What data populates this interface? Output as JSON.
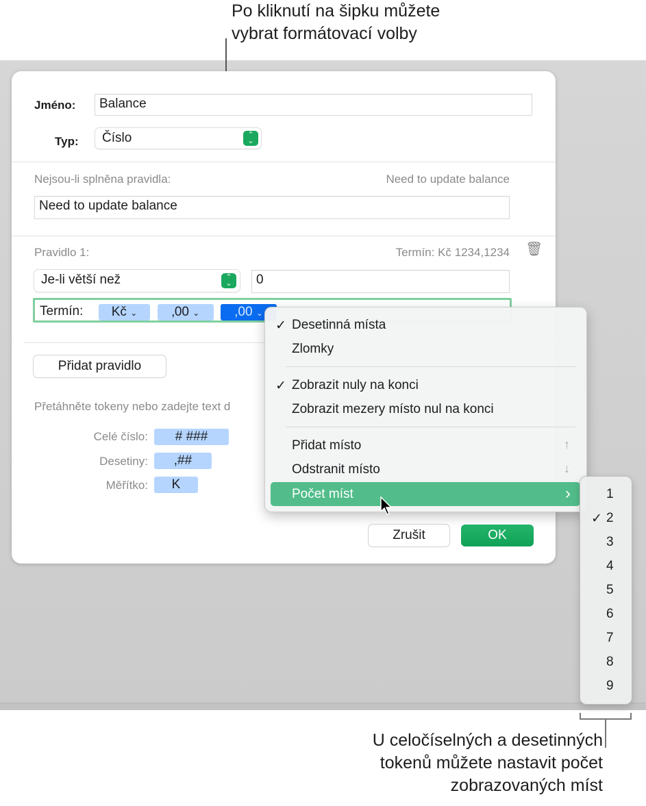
{
  "callouts": {
    "top": [
      "Po kliknutí na šipku můžete",
      "vybrat formátovací volby"
    ],
    "bottom": [
      "U celočíselných a desetinných",
      "tokenů můžete nastavit počet",
      "zobrazovaných míst"
    ]
  },
  "dialog": {
    "name_label": "Jméno:",
    "name_value": "Balance",
    "type_label": "Typ:",
    "type_value": "Číslo",
    "unmet_label": "Nejsou-li splněna pravidla:",
    "unmet_preview": "Need to update balance",
    "unmet_value": "Need to update balance",
    "rule_label": "Pravidlo 1:",
    "rule_preview": "Termín: Kč 1234,1234",
    "condition": "Je-li větší než",
    "condition_value": "0",
    "term_label": "Termín:",
    "tokens": [
      "Kč",
      "‚00",
      ",00"
    ],
    "add_rule": "Přidat pravidlo",
    "hint": "Přetáhněte tokeny nebo zadejte text d",
    "token_rows": [
      {
        "label": "Celé číslo:",
        "token": "# ###"
      },
      {
        "label": "Desetiny:",
        "token": ",##"
      },
      {
        "label": "Měřítko:",
        "token": "K"
      }
    ],
    "cancel": "Zrušit",
    "ok": "OK"
  },
  "menu": {
    "items": [
      {
        "label": "Desetinná místa",
        "checked": true
      },
      {
        "label": "Zlomky",
        "checked": false
      },
      {
        "label": "Zobrazit nuly na konci",
        "checked": true
      },
      {
        "label": "Zobrazit mezery místo nul na konci",
        "checked": false
      },
      {
        "label": "Přidat místo",
        "shortcut": "↑"
      },
      {
        "label": "Odstranit místo",
        "shortcut": "↓"
      },
      {
        "label": "Počet míst",
        "submenu": "›"
      }
    ],
    "check": "✓"
  },
  "submenu": {
    "items": [
      "1",
      "2",
      "3",
      "4",
      "5",
      "6",
      "7",
      "8",
      "9"
    ],
    "selected": "2"
  },
  "colors": {
    "accent": "#1aa85e",
    "highlight": "#52bd8a",
    "token": "#b5d5ff",
    "token_selected": "#0a6cf0"
  }
}
